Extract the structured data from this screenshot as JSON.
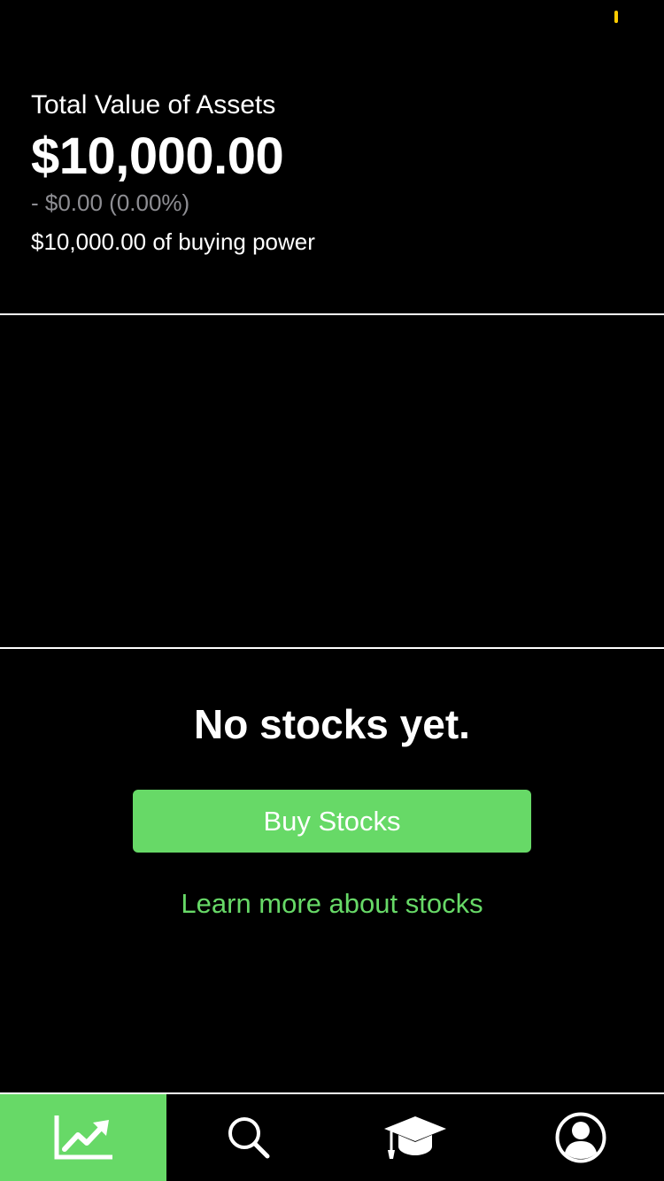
{
  "colors": {
    "background": "#000000",
    "accent": "#67d967",
    "muted_text": "#8e8e93",
    "status_indicator": "#ffcc00"
  },
  "portfolio": {
    "title": "Total Value of Assets",
    "total_value": "$10,000.00",
    "change": "- $0.00 (0.00%)",
    "buying_power": "$10,000.00 of buying power"
  },
  "empty_state": {
    "title": "No stocks yet.",
    "buy_button_label": "Buy Stocks",
    "learn_link_label": "Learn more about stocks"
  },
  "tab_bar": {
    "active_index": 0,
    "tabs": [
      {
        "icon": "chart-trend-icon"
      },
      {
        "icon": "search-icon"
      },
      {
        "icon": "graduation-cap-icon"
      },
      {
        "icon": "profile-icon"
      }
    ]
  }
}
